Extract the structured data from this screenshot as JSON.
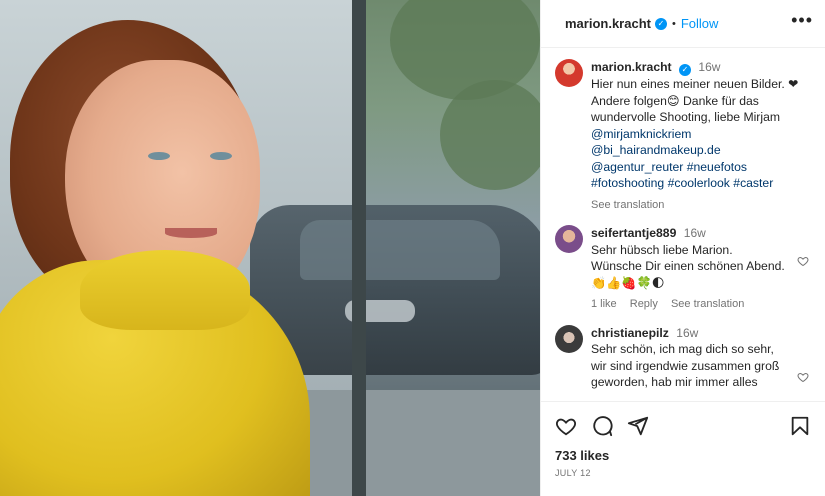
{
  "header": {
    "username": "marion.kracht",
    "separator": "•",
    "follow_label": "Follow",
    "more_label": "•••"
  },
  "icons": {
    "verified": "verified-badge-icon",
    "more": "more-options-icon",
    "like": "heart-icon",
    "comment": "comment-icon",
    "share": "share-icon",
    "save": "bookmark-icon"
  },
  "caption": {
    "username": "marion.kracht",
    "time": "16w",
    "text_lines": [
      "Hier nun eines meiner neuen Bilder. ❤",
      "Andere folgen😊 Danke für das",
      "wundervolle Shooting, liebe Mirjam"
    ],
    "links": [
      "@mirjamknickriem",
      "@bi_hairandmakeup.de",
      "@agentur_reuter #neuefotos",
      "#fotoshooting #coolerlook #caster"
    ],
    "see_translation": "See translation"
  },
  "comments": [
    {
      "username": "seifertantje889",
      "time": "16w",
      "text": "Sehr hübsch liebe Marion.\nWünsche Dir einen schönen Abend.\n👏👍🍓🍀🌓",
      "likes": "1 like",
      "reply": "Reply",
      "see_translation": "See translation"
    },
    {
      "username": "christianepilz",
      "time": "16w",
      "text": "Sehr schön, ich mag dich so sehr,\nwir sind irgendwie zusammen groß\ngeworden, hab mir immer alles"
    }
  ],
  "footer": {
    "likes": "733 likes",
    "date": "JULY 12"
  },
  "colors": {
    "accent": "#0095f6",
    "text": "#262626",
    "muted": "#737373",
    "link": "#00376b",
    "jacket": "#e0bf1f"
  }
}
